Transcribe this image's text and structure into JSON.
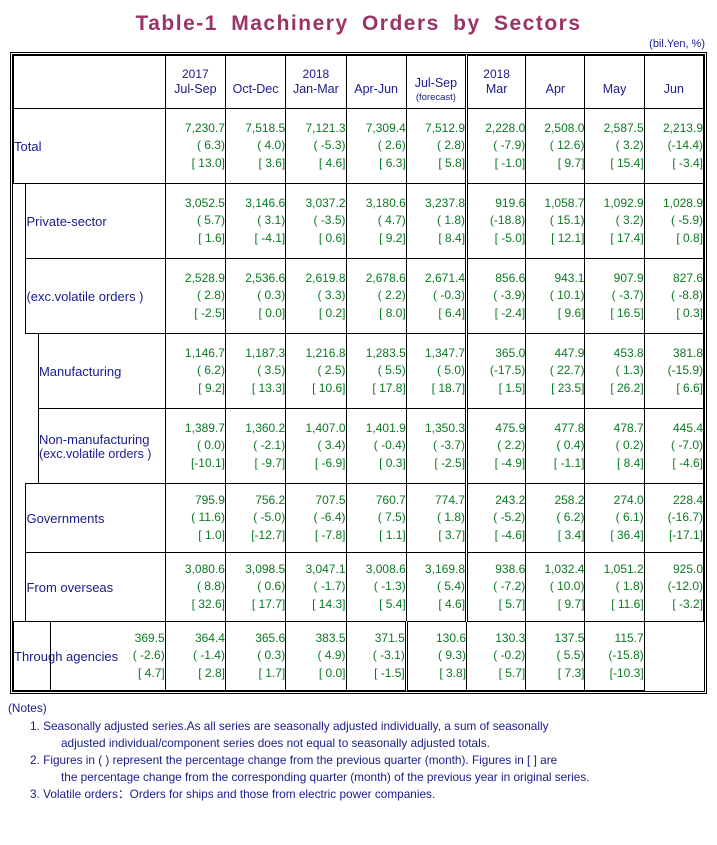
{
  "title": "Table-1  Machinery  Orders  by  Sectors",
  "unit_note": "(bil.Yen, %)",
  "header": {
    "blank": "",
    "columns": [
      {
        "year": "2017",
        "label": "Jul-Sep",
        "sub": ""
      },
      {
        "year": "",
        "label": "Oct-Dec",
        "sub": ""
      },
      {
        "year": "2018",
        "label": "Jan-Mar",
        "sub": ""
      },
      {
        "year": "",
        "label": "Apr-Jun",
        "sub": ""
      },
      {
        "year": "",
        "label": "Jul-Sep",
        "sub": "(forecast)"
      },
      {
        "year": "2018",
        "label": "Mar",
        "sub": ""
      },
      {
        "year": "",
        "label": "Apr",
        "sub": ""
      },
      {
        "year": "",
        "label": "May",
        "sub": ""
      },
      {
        "year": "",
        "label": "Jun",
        "sub": ""
      }
    ]
  },
  "rows": [
    {
      "label": "Total",
      "sublabel": "",
      "indent": 0,
      "values": [
        {
          "v": "7,230.7",
          "p": "(  6.3)",
          "b": "[ 13.0]"
        },
        {
          "v": "7,518.5",
          "p": "(  4.0)",
          "b": "[  3.6]"
        },
        {
          "v": "7,121.3",
          "p": "( -5.3)",
          "b": "[  4.6]"
        },
        {
          "v": "7,309.4",
          "p": "(  2.6)",
          "b": "[  6.3]"
        },
        {
          "v": "7,512.9",
          "p": "(  2.8)",
          "b": "[  5.8]"
        },
        {
          "v": "2,228.0",
          "p": "( -7.9)",
          "b": "[ -1.0]"
        },
        {
          "v": "2,508.0",
          "p": "( 12.6)",
          "b": "[  9.7]"
        },
        {
          "v": "2,587.5",
          "p": "(  3.2)",
          "b": "[ 15.4]"
        },
        {
          "v": "2,213.9",
          "p": "(-14.4)",
          "b": "[ -3.4]"
        }
      ]
    },
    {
      "label": "Private-sector",
      "sublabel": "",
      "indent": 1,
      "values": [
        {
          "v": "3,052.5",
          "p": "(  5.7)",
          "b": "[  1.6]"
        },
        {
          "v": "3,146.6",
          "p": "(  3.1)",
          "b": "[ -4.1]"
        },
        {
          "v": "3,037.2",
          "p": "( -3.5)",
          "b": "[  0.6]"
        },
        {
          "v": "3,180.6",
          "p": "(  4.7)",
          "b": "[  9.2]"
        },
        {
          "v": "3,237.8",
          "p": "(  1.8)",
          "b": "[  8.4]"
        },
        {
          "v": "919.6",
          "p": "(-18.8)",
          "b": "[ -5.0]"
        },
        {
          "v": "1,058.7",
          "p": "( 15.1)",
          "b": "[ 12.1]"
        },
        {
          "v": "1,092.9",
          "p": "(  3.2)",
          "b": "[ 17.4]"
        },
        {
          "v": "1,028.9",
          "p": "( -5.9)",
          "b": "[  0.8]"
        }
      ]
    },
    {
      "label": "(exc.volatile orders )",
      "sublabel": "",
      "indent": 1,
      "values": [
        {
          "v": "2,528.9",
          "p": "(  2.8)",
          "b": "[ -2.5]"
        },
        {
          "v": "2,536.6",
          "p": "(  0.3)",
          "b": "[  0.0]"
        },
        {
          "v": "2,619.8",
          "p": "(  3.3)",
          "b": "[  0.2]"
        },
        {
          "v": "2,678.6",
          "p": "(  2.2)",
          "b": "[  8.0]"
        },
        {
          "v": "2,671.4",
          "p": "( -0.3)",
          "b": "[  6.4]"
        },
        {
          "v": "856.6",
          "p": "( -3.9)",
          "b": "[ -2.4]"
        },
        {
          "v": "943.1",
          "p": "( 10.1)",
          "b": "[  9.6]"
        },
        {
          "v": "907.9",
          "p": "( -3.7)",
          "b": "[ 16.5]"
        },
        {
          "v": "827.6",
          "p": "( -8.8)",
          "b": "[  0.3]"
        }
      ]
    },
    {
      "label": "Manufacturing",
      "sublabel": "",
      "indent": 2,
      "values": [
        {
          "v": "1,146.7",
          "p": "(  6.2)",
          "b": "[  9.2]"
        },
        {
          "v": "1,187.3",
          "p": "(  3.5)",
          "b": "[ 13.3]"
        },
        {
          "v": "1,216.8",
          "p": "(  2.5)",
          "b": "[ 10.6]"
        },
        {
          "v": "1,283.5",
          "p": "(  5.5)",
          "b": "[ 17.8]"
        },
        {
          "v": "1,347.7",
          "p": "(  5.0)",
          "b": "[ 18.7]"
        },
        {
          "v": "365.0",
          "p": "(-17.5)",
          "b": "[  1.5]"
        },
        {
          "v": "447.9",
          "p": "( 22.7)",
          "b": "[ 23.5]"
        },
        {
          "v": "453.8",
          "p": "(  1.3)",
          "b": "[ 26.2]"
        },
        {
          "v": "381.8",
          "p": "(-15.9)",
          "b": "[  6.6]"
        }
      ]
    },
    {
      "label": "Non-manufacturing",
      "sublabel": "(exc.volatile orders )",
      "indent": 2,
      "values": [
        {
          "v": "1,389.7",
          "p": "(  0.0)",
          "b": "[-10.1]"
        },
        {
          "v": "1,360.2",
          "p": "( -2.1)",
          "b": "[ -9.7]"
        },
        {
          "v": "1,407.0",
          "p": "(  3.4)",
          "b": "[ -6.9]"
        },
        {
          "v": "1,401.9",
          "p": "( -0.4)",
          "b": "[  0.3]"
        },
        {
          "v": "1,350.3",
          "p": "( -3.7)",
          "b": "[ -2.5]"
        },
        {
          "v": "475.9",
          "p": "(  2.2)",
          "b": "[ -4.9]"
        },
        {
          "v": "477.8",
          "p": "(  0.4)",
          "b": "[ -1.1]"
        },
        {
          "v": "478.7",
          "p": "(  0.2)",
          "b": "[  8.4]"
        },
        {
          "v": "445.4",
          "p": "( -7.0)",
          "b": "[ -4.6]"
        }
      ]
    },
    {
      "label": "Governments",
      "sublabel": "",
      "indent": 1,
      "values": [
        {
          "v": "795.9",
          "p": "( 11.6)",
          "b": "[  1.0]"
        },
        {
          "v": "756.2",
          "p": "( -5.0)",
          "b": "[-12.7]"
        },
        {
          "v": "707.5",
          "p": "( -6.4)",
          "b": "[ -7.8]"
        },
        {
          "v": "760.7",
          "p": "(  7.5)",
          "b": "[  1.1]"
        },
        {
          "v": "774.7",
          "p": "(  1.8)",
          "b": "[  3.7]"
        },
        {
          "v": "243.2",
          "p": "( -5.2)",
          "b": "[ -4.6]"
        },
        {
          "v": "258.2",
          "p": "(  6.2)",
          "b": "[  3.4]"
        },
        {
          "v": "274.0",
          "p": "(  6.1)",
          "b": "[ 36.4]"
        },
        {
          "v": "228.4",
          "p": "(-16.7)",
          "b": "[-17.1]"
        }
      ]
    },
    {
      "label": "From overseas",
      "sublabel": "",
      "indent": 1,
      "values": [
        {
          "v": "3,080.6",
          "p": "(  8.8)",
          "b": "[ 32.6]"
        },
        {
          "v": "3,098.5",
          "p": "(  0.6)",
          "b": "[ 17.7]"
        },
        {
          "v": "3,047.1",
          "p": "( -1.7)",
          "b": "[ 14.3]"
        },
        {
          "v": "3,008.6",
          "p": "( -1.3)",
          "b": "[  5.4]"
        },
        {
          "v": "3,169.8",
          "p": "(  5.4)",
          "b": "[  4.6]"
        },
        {
          "v": "938.6",
          "p": "( -7.2)",
          "b": "[  5.7]"
        },
        {
          "v": "1,032.4",
          "p": "( 10.0)",
          "b": "[  9.7]"
        },
        {
          "v": "1,051.2",
          "p": "(  1.8)",
          "b": "[ 11.6]"
        },
        {
          "v": "925.0",
          "p": "(-12.0)",
          "b": "[ -3.2]"
        }
      ]
    },
    {
      "label": "Through agencies",
      "sublabel": "",
      "indent": 1,
      "values": [
        {
          "v": "369.5",
          "p": "( -2.6)",
          "b": "[  4.7]"
        },
        {
          "v": "364.4",
          "p": "( -1.4)",
          "b": "[  2.8]"
        },
        {
          "v": "365.6",
          "p": "(  0.3)",
          "b": "[  1.7]"
        },
        {
          "v": "383.5",
          "p": "(  4.9)",
          "b": "[  0.0]"
        },
        {
          "v": "371.5",
          "p": "( -3.1)",
          "b": "[ -1.5]"
        },
        {
          "v": "130.6",
          "p": "(  9.3)",
          "b": "[  3.8]"
        },
        {
          "v": "130.3",
          "p": "( -0.2)",
          "b": "[  5.7]"
        },
        {
          "v": "137.5",
          "p": "(  5.5)",
          "b": "[  7.3]"
        },
        {
          "v": "115.7",
          "p": "(-15.8)",
          "b": "[-10.3]"
        }
      ]
    }
  ],
  "notes": {
    "heading": "(Notes)",
    "items": [
      {
        "num": "1.",
        "line1": "Seasonally adjusted series.As all series are seasonally adjusted individually, a sum of seasonally",
        "line2": "adjusted individual/component series does not equal to seasonally adjusted totals."
      },
      {
        "num": "2.",
        "line1": "Figures in ( ) represent the percentage change from the previous quarter (month). Figures in [ ] are",
        "line2": "the percentage change from the corresponding quarter (month) of the previous year in original series."
      },
      {
        "num": "3.",
        "line1": "Volatile orders：Orders for ships and those from electric power companies.",
        "line2": ""
      }
    ]
  },
  "colors": {
    "title": "#9c3366",
    "label_text": "#1a1a8c",
    "value_text": "#0a7a22",
    "border": "#000000"
  }
}
